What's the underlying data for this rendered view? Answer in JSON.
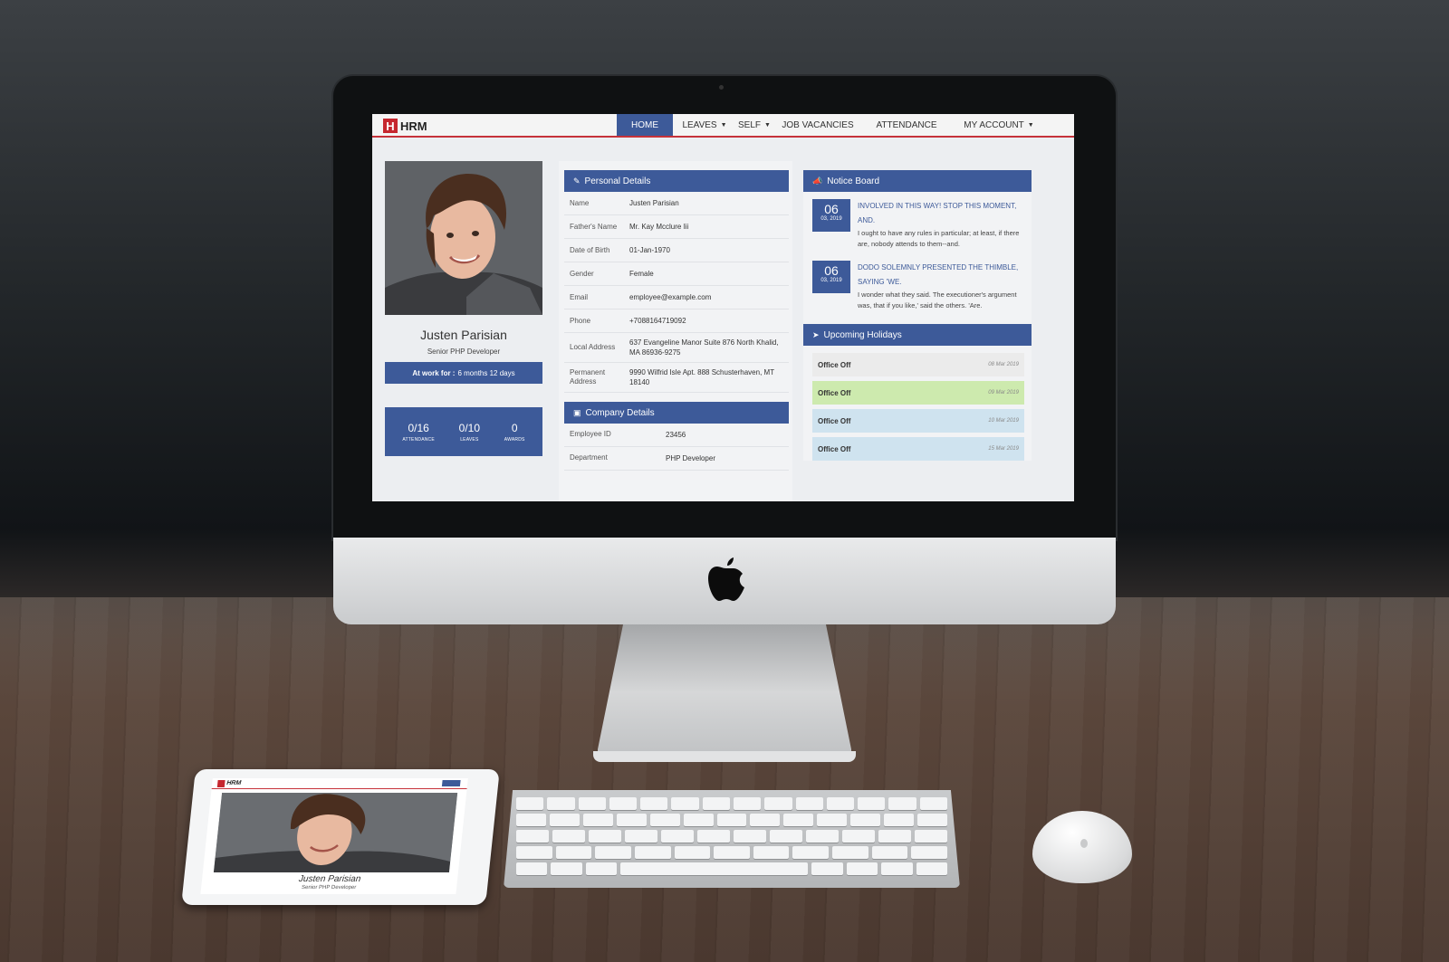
{
  "app": {
    "brand_letter": "H",
    "brand_name": "HRM"
  },
  "nav": {
    "items": [
      {
        "label": "HOME",
        "active": true
      },
      {
        "label": "LEAVES",
        "dropdown": true
      },
      {
        "label": "SELF",
        "dropdown": true
      },
      {
        "label": "JOB VACANCIES"
      },
      {
        "label": "ATTENDANCE"
      },
      {
        "label": "MY ACCOUNT",
        "dropdown": true
      }
    ]
  },
  "profile": {
    "name": "Justen Parisian",
    "role": "Senior PHP Developer",
    "work_label": "At work for :",
    "work_value": "6 months 12 days",
    "stats": [
      {
        "value": "0/16",
        "label": "ATTENDANCE"
      },
      {
        "value": "0/10",
        "label": "LEAVES"
      },
      {
        "value": "0",
        "label": "AWARDS"
      }
    ]
  },
  "personal": {
    "title": "Personal Details",
    "rows": [
      {
        "key": "Name",
        "value": "Justen Parisian"
      },
      {
        "key": "Father's Name",
        "value": "Mr. Kay Mcclure Iii"
      },
      {
        "key": "Date of Birth",
        "value": "01-Jan-1970"
      },
      {
        "key": "Gender",
        "value": "Female"
      },
      {
        "key": "Email",
        "value": "employee@example.com"
      },
      {
        "key": "Phone",
        "value": "+7088164719092"
      },
      {
        "key": "Local Address",
        "value": "637 Evangeline Manor Suite 876 North Khalid, MA 86936-9275"
      },
      {
        "key": "Permanent Address",
        "value": "9990 Wilfrid Isle Apt. 888 Schusterhaven, MT 18140"
      }
    ]
  },
  "company": {
    "title": "Company Details",
    "rows": [
      {
        "key": "Employee ID",
        "value": "23456"
      },
      {
        "key": "Department",
        "value": "PHP Developer"
      }
    ]
  },
  "notice_board": {
    "title": "Notice Board",
    "notices": [
      {
        "day": "06",
        "month_year": "03, 2019",
        "title": "INVOLVED IN THIS WAY! STOP THIS MOMENT, AND.",
        "body": "I ought to have any rules in particular; at least, if there are, nobody attends to them--and."
      },
      {
        "day": "06",
        "month_year": "03, 2019",
        "title": "DODO SOLEMNLY PRESENTED THE THIMBLE, SAYING 'WE.",
        "body": "I wonder what they said. The executioner's argument was, that if you like,' said the others. 'Are."
      }
    ]
  },
  "holidays": {
    "title": "Upcoming Holidays",
    "items": [
      {
        "name": "Office Off",
        "date": "08 Mar 2019",
        "color": "#ebebeb"
      },
      {
        "name": "Office Off",
        "date": "09 Mar 2019",
        "color": "#cdeaae"
      },
      {
        "name": "Office Off",
        "date": "10 Mar 2019",
        "color": "#cfe3ef"
      },
      {
        "name": "Office Off",
        "date": "15 Mar 2019",
        "color": "#cfe3ef"
      }
    ]
  },
  "tablet": {
    "brand_name": "HRM",
    "name": "Justen Parisian",
    "role": "Senior PHP Developer"
  },
  "colors": {
    "primary": "#3d5a99",
    "brand_red": "#c6272f"
  }
}
